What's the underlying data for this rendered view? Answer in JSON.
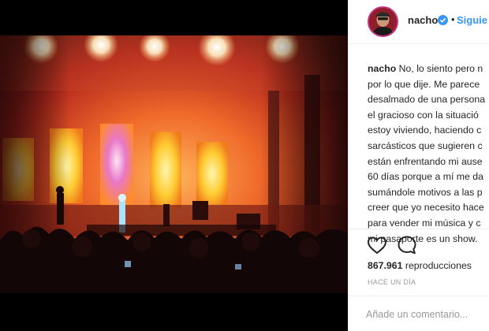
{
  "post": {
    "media": {
      "type": "video",
      "icon": "concert-video-frame"
    },
    "header": {
      "username": "nacho",
      "verified_icon": "verified-badge-icon",
      "separator": "•",
      "follow_label": "Siguie"
    },
    "caption": {
      "username": "nacho",
      "first_line_text": " No, lo siento pero n",
      "lines": [
        "por lo que dije. Me parece",
        "desalmado de una persona",
        "el gracioso con la situació",
        "estoy viviendo, haciendo c",
        "sarcásticos que sugieren c",
        "están enfrentando mi ause",
        "60 días porque a mí me da",
        "sumándole motivos a las p",
        "creer que yo necesito hace",
        "para vender mi música y c",
        "mi pasaporte es un show."
      ]
    },
    "actions": {
      "like_icon": "heart-outline-icon",
      "comment_icon": "comment-bubble-icon"
    },
    "stats": {
      "views_count": "867.961",
      "views_label": " reproducciones",
      "time_label": "HACE UN DÍA"
    },
    "comment_box": {
      "placeholder": "Añade un comentario..."
    },
    "colors": {
      "link_blue": "#3897f0",
      "text": "#262626",
      "muted": "#999999",
      "divider": "#efefef",
      "stage_orange": "#e8532a",
      "stage_yellow": "#ffd84a"
    }
  }
}
